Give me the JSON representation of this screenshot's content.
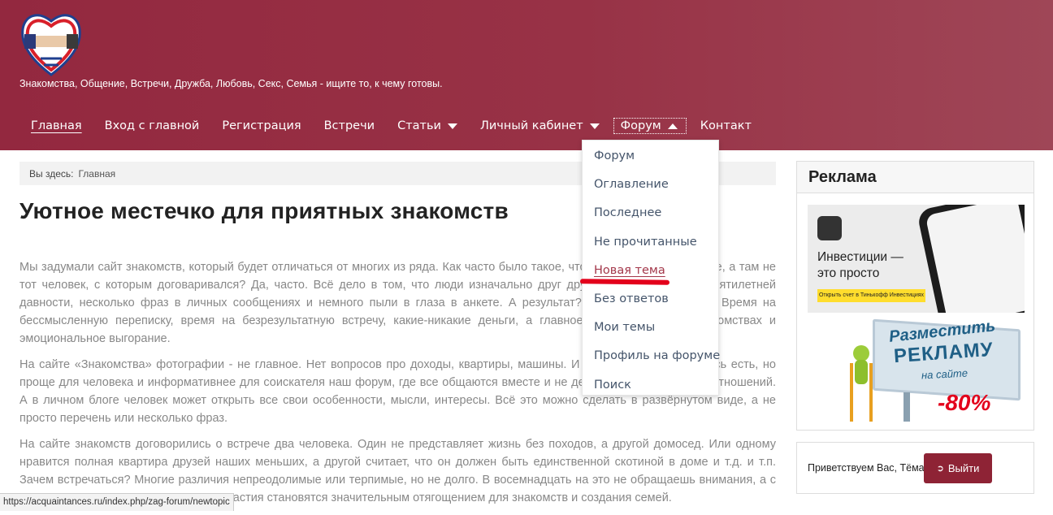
{
  "header": {
    "tagline": "Знакомства, Общение, Встречи, Дружба, Любовь, Секс, Семья - ищите то, к чему готовы."
  },
  "nav": {
    "items": [
      {
        "label": "Главная"
      },
      {
        "label": "Вход с главной"
      },
      {
        "label": "Регистрация"
      },
      {
        "label": "Встречи"
      },
      {
        "label": "Статьи"
      },
      {
        "label": "Личный кабинет"
      },
      {
        "label": "Форум"
      },
      {
        "label": "Контакт"
      }
    ]
  },
  "forum_menu": {
    "items": [
      {
        "label": "Форум"
      },
      {
        "label": "Оглавление"
      },
      {
        "label": "Последнее"
      },
      {
        "label": "Не прочитанные"
      },
      {
        "label": "Новая тема"
      },
      {
        "label": "Без ответов"
      },
      {
        "label": "Мои темы"
      },
      {
        "label": "Профиль на форуме"
      },
      {
        "label": "Поиск"
      }
    ]
  },
  "breadcrumb": {
    "prefix": "Вы здесь:",
    "current": "Главная"
  },
  "page": {
    "title": "Уютное местечко для приятных знакомств",
    "paragraphs": [
      "Мы задумали сайт знакомств, который будет отличаться от многих из ряда. Как часто было такое, что договорились о встрече, а там не тот человек, с которым договаривался? Да, часто. Всё дело в том, что люди изначально друг друга обманывают: фото пятилетней давности, несколько фраз в личных сообщениях и немного пыли в глаза в анкете. А результат? Ну, вы и сами знаете. Время на бессмысленную переписку, время на безрезультатную встречу, какие-никакие деньги, а главное разочарование в знакомствах и эмоциональное выгорание.",
      "На сайте «Знакомства» фотографии - не главное. Нет вопросов про доходы, квартиры, машины. И личные сообщения здесь есть, но проще для человека и информативнее для соискателя наш форум, где все общаются вместе и не делают секрета из своих отношений. А в личном блоге человек может открыть все свои особенности, мысли, интересы. Всё это можно сделать в развёрнутом виде, а не просто перечень или несколько фраз.",
      "На сайте знакомств договорились о встрече два человека. Один не представляет жизнь без походов, а другой домосед. Или одному нравится полная квартира друзей наших меньших, а другой считает, что он должен быть единственной скотиной в доме и т.д. и т.п. Зачем встречаться? Многие различия непреодолимые или терпимые, но не долго. В восемнадцать на это не обращаешь внимания, а с возрастом различия, привычки, пристрастия становятся значительным отягощением для знакомств и создания семей."
    ]
  },
  "sidebar": {
    "ad_title": "Реклама",
    "banner1": {
      "line1": "Инвестиции —",
      "line2": "это просто",
      "button": "Открыть счет в Тинькофф Инвестициях"
    },
    "banner2": {
      "line1": "Разместить",
      "line2": "РЕКЛАМУ",
      "line3": "на сайте",
      "discount": "-80%"
    }
  },
  "user": {
    "greeting": "Приветствуем Вас, Тёма",
    "logout_label": "Выйти"
  },
  "status_bar": {
    "url": "https://acquaintances.ru/index.php/zag-forum/newtopic"
  },
  "colors": {
    "header_bg": "#93283f",
    "accent": "#8e2335",
    "menu_text": "#44546a",
    "highlight_mark": "#e3001b"
  }
}
